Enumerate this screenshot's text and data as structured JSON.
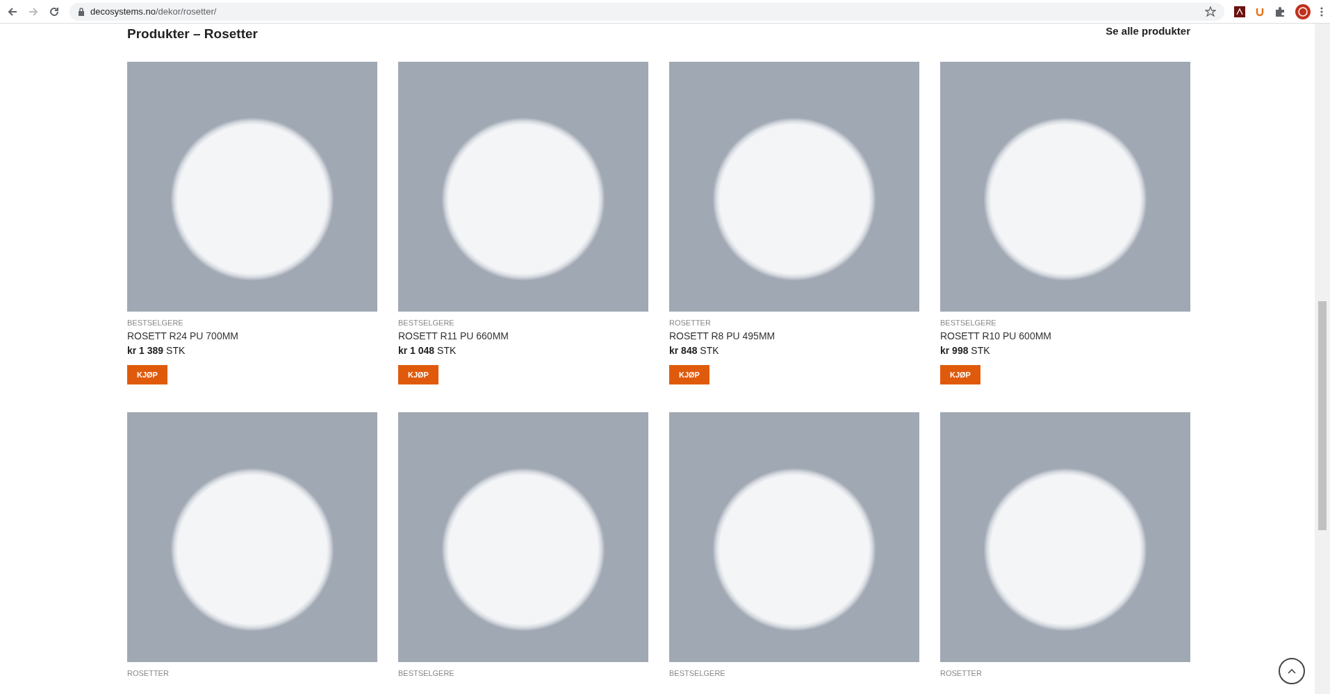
{
  "browser": {
    "url_host": "decosystems.no",
    "url_path": "/dekor/rosetter/"
  },
  "section": {
    "title": "Produkter – Rosetter",
    "see_all": "Se alle produkter"
  },
  "products": [
    {
      "category": "BESTSELGERE",
      "name": "ROSETT R24 PU 700MM",
      "price": "kr 1 389",
      "unit": "STK",
      "button": "KJØP"
    },
    {
      "category": "BESTSELGERE",
      "name": "ROSETT R11 PU 660MM",
      "price": "kr 1 048",
      "unit": "STK",
      "button": "KJØP"
    },
    {
      "category": "ROSETTER",
      "name": "ROSETT R8 PU 495MM",
      "price": "kr 848",
      "unit": "STK",
      "button": "KJØP"
    },
    {
      "category": "BESTSELGERE",
      "name": "ROSETT R10 PU 600MM",
      "price": "kr 998",
      "unit": "STK",
      "button": "KJØP"
    },
    {
      "category": "ROSETTER"
    },
    {
      "category": "BESTSELGERE"
    },
    {
      "category": "BESTSELGERE"
    },
    {
      "category": "ROSETTER"
    }
  ]
}
